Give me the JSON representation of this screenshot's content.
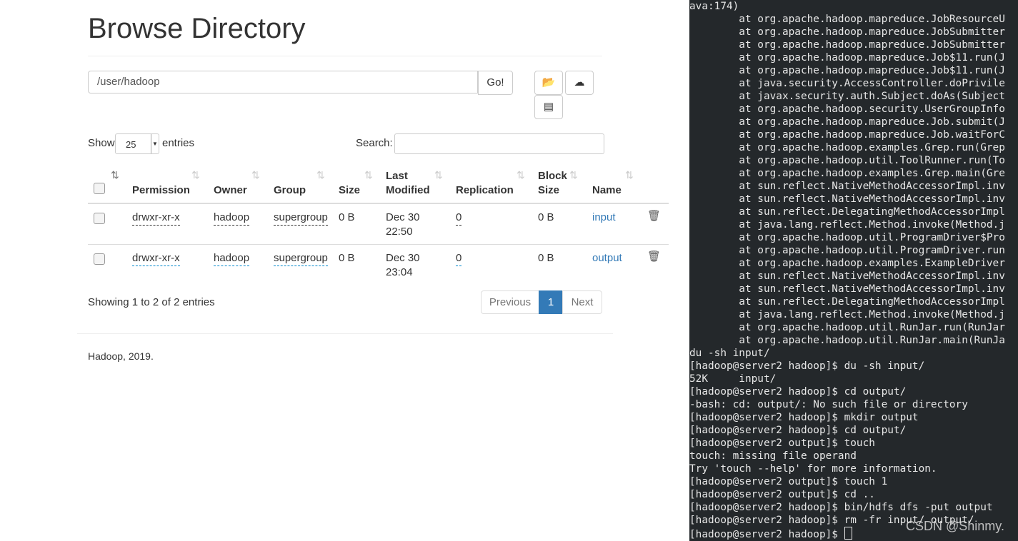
{
  "page": {
    "title": "Browse Directory"
  },
  "path_bar": {
    "value": "/user/hadoop",
    "go_label": "Go!"
  },
  "toolbar": {
    "icons": [
      "folder-open-icon",
      "upload-icon",
      "list-icon"
    ]
  },
  "length": {
    "show": "Show",
    "value": "25",
    "entries": "entries"
  },
  "search": {
    "label": "Search:",
    "value": ""
  },
  "table": {
    "headers": [
      "Permission",
      "Owner",
      "Group",
      "Size",
      "Last",
      "Modified",
      "Replication",
      "Block",
      "Size",
      "Name"
    ],
    "rows": [
      {
        "permission": "drwxr-xr-x",
        "owner": "hadoop",
        "group": "supergroup",
        "size": "0 B",
        "date": "Dec 30",
        "time": "22:50",
        "replication": "0",
        "block_size": "0 B",
        "name": "input"
      },
      {
        "permission": "drwxr-xr-x",
        "owner": "hadoop",
        "group": "supergroup",
        "size": "0 B",
        "date": "Dec 30",
        "time": "23:04",
        "replication": "0",
        "block_size": "0 B",
        "name": "output"
      }
    ]
  },
  "info": "Showing 1 to 2 of 2 entries",
  "pagination": {
    "previous": "Previous",
    "current": "1",
    "next": "Next",
    "accent": "#337ab7"
  },
  "footer": "Hadoop, 2019.",
  "terminal": {
    "lines": [
      "ava:174)",
      "        at org.apache.hadoop.mapreduce.JobResourceU",
      "        at org.apache.hadoop.mapreduce.JobSubmitter",
      "        at org.apache.hadoop.mapreduce.JobSubmitter",
      "        at org.apache.hadoop.mapreduce.Job$11.run(J",
      "        at org.apache.hadoop.mapreduce.Job$11.run(J",
      "        at java.security.AccessController.doPrivile",
      "        at javax.security.auth.Subject.doAs(Subject",
      "        at org.apache.hadoop.security.UserGroupInfo",
      "        at org.apache.hadoop.mapreduce.Job.submit(J",
      "        at org.apache.hadoop.mapreduce.Job.waitForC",
      "        at org.apache.hadoop.examples.Grep.run(Grep",
      "        at org.apache.hadoop.util.ToolRunner.run(To",
      "        at org.apache.hadoop.examples.Grep.main(Gre",
      "        at sun.reflect.NativeMethodAccessorImpl.inv",
      "        at sun.reflect.NativeMethodAccessorImpl.inv",
      "        at sun.reflect.DelegatingMethodAccessorImpl",
      "        at java.lang.reflect.Method.invoke(Method.j",
      "        at org.apache.hadoop.util.ProgramDriver$Pro",
      "        at org.apache.hadoop.util.ProgramDriver.run",
      "        at org.apache.hadoop.examples.ExampleDriver",
      "        at sun.reflect.NativeMethodAccessorImpl.inv",
      "        at sun.reflect.NativeMethodAccessorImpl.inv",
      "        at sun.reflect.DelegatingMethodAccessorImpl",
      "        at java.lang.reflect.Method.invoke(Method.j",
      "        at org.apache.hadoop.util.RunJar.run(RunJar",
      "        at org.apache.hadoop.util.RunJar.main(RunJa",
      "du -sh input/",
      "[hadoop@server2 hadoop]$ du -sh input/",
      "52K     input/",
      "[hadoop@server2 hadoop]$ cd output/",
      "-bash: cd: output/: No such file or directory",
      "[hadoop@server2 hadoop]$ mkdir output",
      "[hadoop@server2 hadoop]$ cd output/",
      "[hadoop@server2 output]$ touch",
      "touch: missing file operand",
      "Try 'touch --help' for more information.",
      "[hadoop@server2 output]$ touch 1",
      "[hadoop@server2 output]$ cd ..",
      "[hadoop@server2 hadoop]$ bin/hdfs dfs -put output",
      "[hadoop@server2 hadoop]$ rm -fr input/ output/",
      "[hadoop@server2 hadoop]$ "
    ]
  },
  "watermark": "CSDN @Shinmy."
}
